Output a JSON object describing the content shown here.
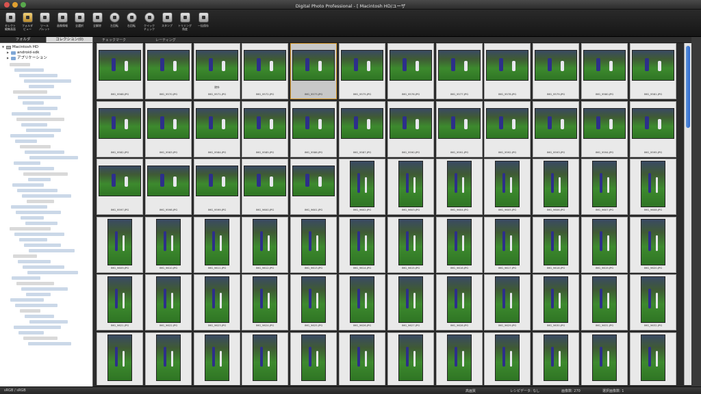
{
  "window": {
    "title": "Digital Photo Professional - [ Macintosh HD/ユーザ"
  },
  "toolbar": [
    {
      "label": "セレクト\n編集画面",
      "icon": "select-edit-icon"
    },
    {
      "label": "フォルダ\nビュー",
      "icon": "folder-view-icon",
      "active": true
    },
    {
      "label": "ツール\nパレット",
      "icon": "tool-palette-icon"
    },
    {
      "label": "画像情報",
      "icon": "image-info-icon"
    },
    {
      "label": "全選択",
      "icon": "select-all-icon"
    },
    {
      "label": "全解除",
      "icon": "deselect-all-icon"
    },
    {
      "label": "左回転",
      "icon": "rotate-left-icon"
    },
    {
      "label": "右回転",
      "icon": "rotate-right-icon"
    },
    {
      "label": "クイック\nチェック",
      "icon": "quick-check-icon"
    },
    {
      "label": "スタンプ",
      "icon": "stamp-icon"
    },
    {
      "label": "トリミング\n角度",
      "icon": "trim-angle-icon"
    },
    {
      "label": "一括保存",
      "icon": "batch-save-icon"
    }
  ],
  "left_panel": {
    "tabs": [
      {
        "label": "フォルダ"
      },
      {
        "label": "コレクション(0)"
      }
    ],
    "tree": [
      {
        "label": "Macintosh HD",
        "icon": "hard-drive-icon",
        "level": 0,
        "expanded": true
      },
      {
        "label": "android-sdk",
        "icon": "folder-icon",
        "level": 1,
        "expanded": false
      },
      {
        "label": "アプリケーション",
        "icon": "folder-icon",
        "level": 1,
        "expanded": false
      }
    ]
  },
  "filter_bar": {
    "check_mark": "チェックマーク",
    "rating": "レーティング"
  },
  "thumbnails": [
    "IMG_9568.JPG",
    "IMG_9570.JPG",
    "IMG_9571.JPG",
    "IMG_9572.JPG",
    "IMG_9573.JPG",
    "IMG_9575.JPG",
    "IMG_9576.JPG",
    "IMG_9577.JPG",
    "IMG_9578.JPG",
    "IMG_9579.JPG",
    "IMG_9580.JPG",
    "IMG_9581.JPG",
    "IMG_9582.JPG",
    "IMG_9583.JPG",
    "IMG_9584.JPG",
    "IMG_9585.JPG",
    "IMG_9586.JPG",
    "IMG_9587.JPG",
    "IMG_9590.JPG",
    "IMG_9591.JPG",
    "IMG_9592.JPG",
    "IMG_9593.JPG",
    "IMG_9594.JPG",
    "IMG_9595.JPG",
    "IMG_9597.JPG",
    "IMG_9598.JPG",
    "IMG_9599.JPG",
    "IMG_9600.JPG",
    "IMG_9601.JPG",
    "IMG_9602.JPG",
    "IMG_9603.JPG",
    "IMG_9604.JPG",
    "IMG_9605.JPG",
    "IMG_9606.JPG",
    "IMG_9607.JPG",
    "IMG_9608.JPG",
    "IMG_9609.JPG",
    "IMG_9610.JPG",
    "IMG_9611.JPG",
    "IMG_9612.JPG",
    "IMG_9613.JPG",
    "IMG_9614.JPG",
    "IMG_9615.JPG",
    "IMG_9616.JPG",
    "IMG_9617.JPG",
    "IMG_9618.JPG",
    "IMG_9619.JPG",
    "IMG_9620.JPG",
    "IMG_9621.JPG",
    "IMG_9622.JPG",
    "IMG_9623.JPG",
    "IMG_9624.JPG",
    "IMG_9625.JPG",
    "IMG_9626.JPG",
    "IMG_9627.JPG",
    "IMG_9628.JPG",
    "IMG_9629.JPG",
    "IMG_9630.JPG",
    "IMG_9631.JPG",
    "IMG_9632.JPG",
    "",
    "",
    "",
    "",
    "",
    "",
    "",
    "",
    "",
    "",
    "",
    ""
  ],
  "thumb_orientation": [
    "L",
    "L",
    "L",
    "L",
    "L",
    "L",
    "L",
    "L",
    "L",
    "L",
    "L",
    "L",
    "L",
    "L",
    "L",
    "L",
    "L",
    "L",
    "L",
    "L",
    "L",
    "L",
    "L",
    "L",
    "L",
    "L",
    "L",
    "L",
    "L",
    "P",
    "P",
    "P",
    "P",
    "P",
    "P",
    "P",
    "P",
    "P",
    "P",
    "P",
    "P",
    "P",
    "P",
    "P",
    "P",
    "P",
    "P",
    "P",
    "P",
    "P",
    "P",
    "P",
    "P",
    "P",
    "P",
    "P",
    "P",
    "P",
    "P",
    "P",
    "P",
    "P",
    "P",
    "P",
    "P",
    "P",
    "P",
    "P",
    "P",
    "P",
    "P",
    "P"
  ],
  "selected_thumb": 4,
  "thumb_mark": {
    "index": 2,
    "text": "除外"
  },
  "status_bar": {
    "color_space": "sRGB / sRGB",
    "quality": "高画質",
    "recipe": "レシピデータ: なし",
    "image_count": "画像数: 270",
    "selected_count": "選択画像数: 1"
  }
}
